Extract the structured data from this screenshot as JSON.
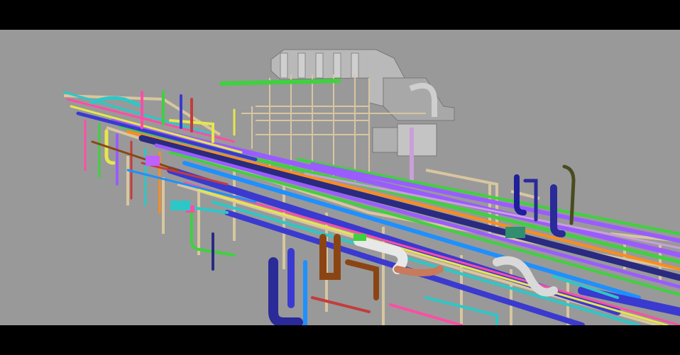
{
  "scene": {
    "subject": "3d-plant-piping-model",
    "background_color": "#999999",
    "letterbox_color": "#000000",
    "pipe_colors": [
      "#3a3ad0",
      "#9a5cff",
      "#3fd13f",
      "#ff8c1a",
      "#e6e64d",
      "#2ec7c7",
      "#ff4da6",
      "#d9c29a",
      "#ffffff",
      "#8b4513",
      "#c43c3c",
      "#1e90ff"
    ],
    "steel_color": "#d8c6a0",
    "equipment_color": "#b9b9b9"
  }
}
